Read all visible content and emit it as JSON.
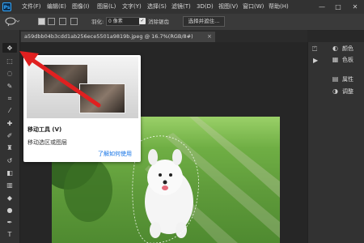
{
  "app": {
    "logo": "Ps"
  },
  "menu": [
    "文件(F)",
    "编辑(E)",
    "图像(I)",
    "图层(L)",
    "文字(Y)",
    "选择(S)",
    "滤镜(T)",
    "3D(D)",
    "视图(V)",
    "窗口(W)",
    "帮助(H)"
  ],
  "window_controls": {
    "minimize": "—",
    "maximize": "□",
    "close": "✕"
  },
  "options": {
    "feather_label": "羽化:",
    "feather_value": "0 像素",
    "antialias_label": "消除锯齿",
    "antialias_checked": true,
    "select_subject_label": "选择并遮住..."
  },
  "document_tab": {
    "title": "a59dbb04b3cdd1ab256ece5501a9819b.jpeg @ 16.7%(RGB/8#)",
    "close": "×"
  },
  "panels": {
    "color_label": "颜色",
    "swatches_label": "色板",
    "properties_label": "属性",
    "adjustments_label": "调整"
  },
  "tooltip": {
    "title": "移动工具 (V)",
    "description": "移动选区或图层",
    "link": "了解如何使用"
  },
  "colors": {
    "annotation_arrow": "#e02020",
    "link": "#1473e6",
    "active_tool_bg": "#1f1f1f"
  },
  "icons": [
    "move-icon",
    "marquee-icon",
    "lasso-icon",
    "quick-select-icon",
    "crop-icon",
    "eyedropper-icon",
    "healing-brush-icon",
    "brush-icon",
    "stamp-icon",
    "history-brush-icon",
    "eraser-icon",
    "gradient-icon",
    "blur-icon",
    "dodge-icon",
    "pen-icon",
    "type-icon"
  ]
}
